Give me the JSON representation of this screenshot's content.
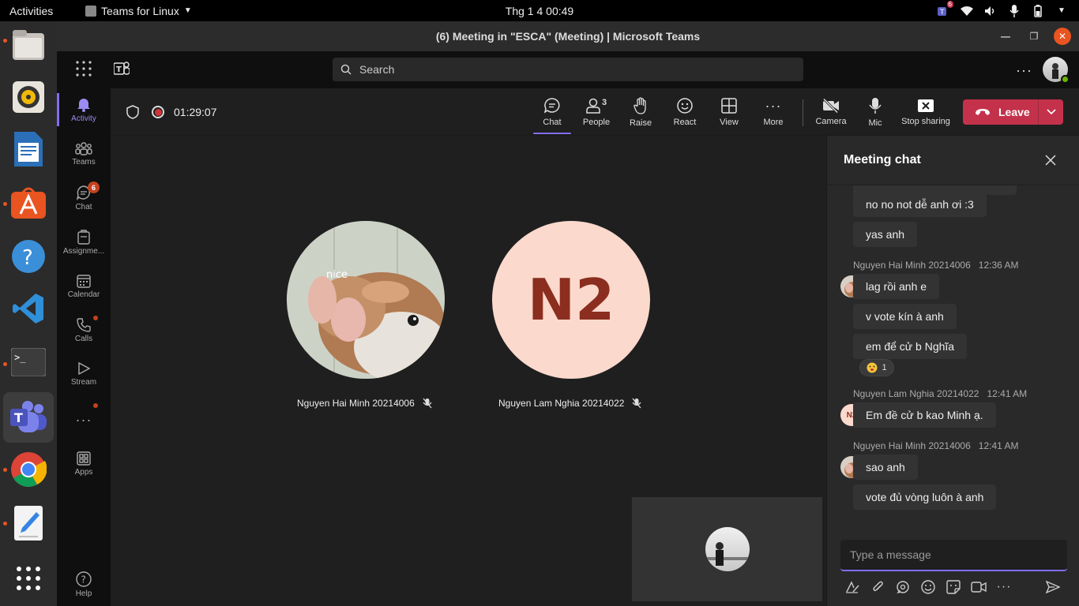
{
  "system_bar": {
    "activities": "Activities",
    "app_menu": "Teams for Linux",
    "clock": "Thg 1 4  00:49",
    "tray_badge": "6"
  },
  "window": {
    "title": "(6) Meeting in \"ESCA\" (Meeting) | Microsoft Teams"
  },
  "teams_header": {
    "search_placeholder": "Search"
  },
  "rail": {
    "items": [
      {
        "label": "Activity"
      },
      {
        "label": "Teams"
      },
      {
        "label": "Chat",
        "badge": "6"
      },
      {
        "label": "Assignme..."
      },
      {
        "label": "Calendar"
      },
      {
        "label": "Calls"
      },
      {
        "label": "Stream"
      },
      {
        "label": "Apps"
      },
      {
        "label": "Help"
      }
    ]
  },
  "meeting": {
    "timer": "01:29:07",
    "toolbar": {
      "chat": "Chat",
      "people": "People",
      "people_count": "3",
      "raise": "Raise",
      "react": "React",
      "view": "View",
      "more": "More",
      "camera": "Camera",
      "mic": "Mic",
      "stop_sharing": "Stop sharing",
      "leave": "Leave"
    },
    "participants": [
      {
        "name": "Nguyen Hai Minh 20214006",
        "avatar_text": "nice"
      },
      {
        "name": "Nguyen Lam Nghia 20214022",
        "initials": "N2"
      }
    ]
  },
  "chat": {
    "title": "Meeting chat",
    "messages": [
      {
        "text": "no no not dễ anh ơi :3"
      },
      {
        "text": "yas anh"
      },
      {
        "sender": "Nguyen Hai Minh 20214006",
        "time": "12:36 AM",
        "text": "lag rồi anh e"
      },
      {
        "text": "v vote kín à anh"
      },
      {
        "text": "em để cử b Nghĩa",
        "reaction_count": "1"
      },
      {
        "sender": "Nguyen Lam Nghia 20214022",
        "time": "12:41 AM",
        "initials": "N2",
        "text": "Em đề cử b kao Minh ạ."
      },
      {
        "sender": "Nguyen Hai Minh 20214006",
        "time": "12:41 AM",
        "text": "sao anh"
      },
      {
        "text": "vote đủ vòng luôn à anh"
      }
    ],
    "compose_placeholder": "Type a message"
  },
  "colors": {
    "accent": "#7f6ff0",
    "leave": "#c4314b",
    "badge": "#c4421e",
    "ubuntu_orange": "#e95420"
  }
}
